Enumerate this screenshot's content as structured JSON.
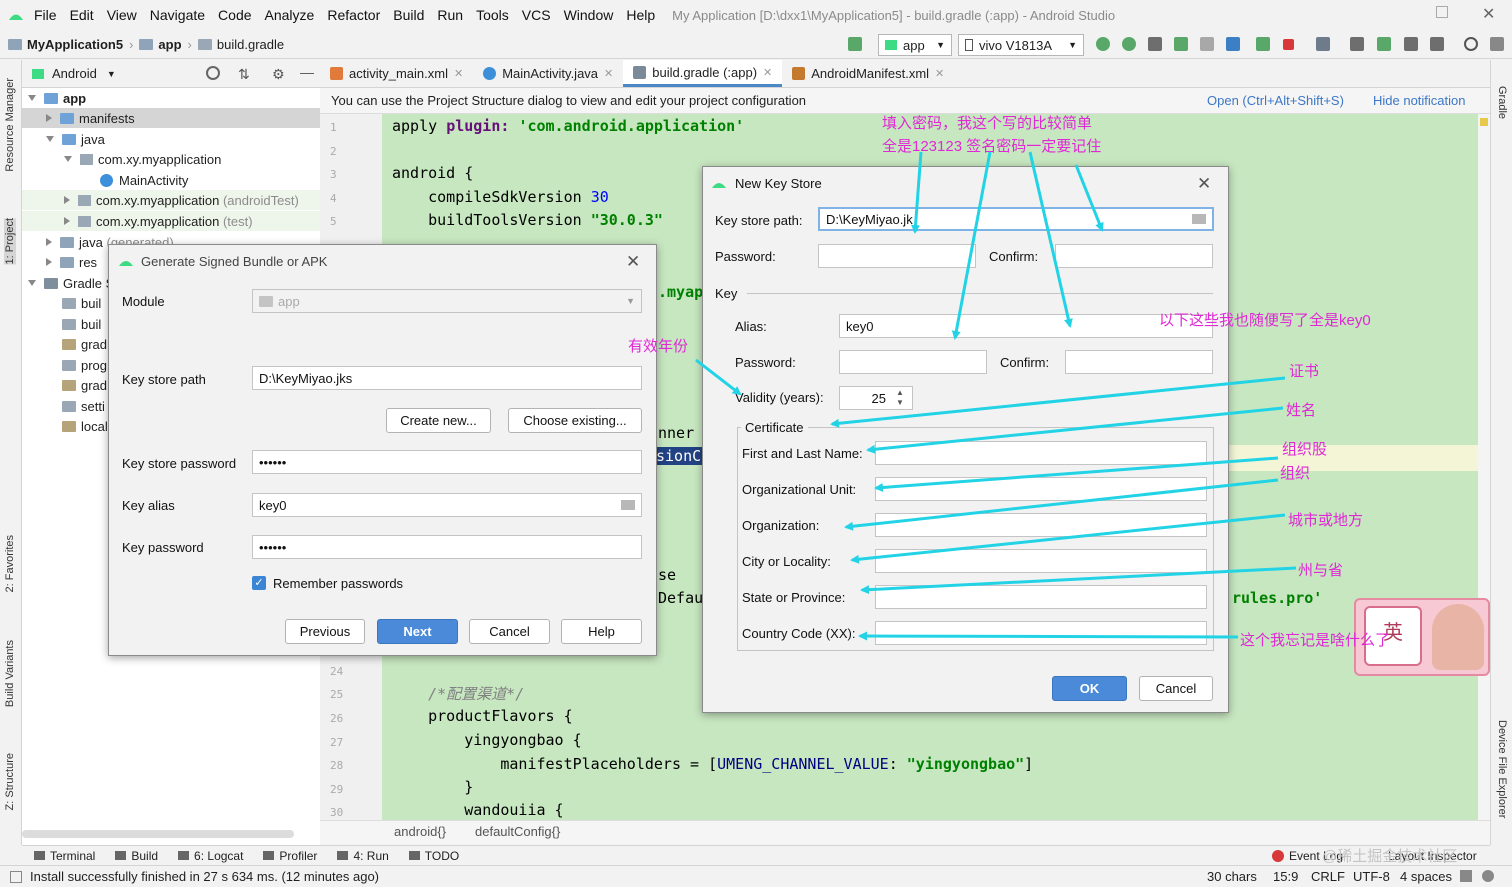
{
  "menubar": {
    "items": [
      "File",
      "Edit",
      "View",
      "Navigate",
      "Code",
      "Analyze",
      "Refactor",
      "Build",
      "Run",
      "Tools",
      "VCS",
      "Window",
      "Help"
    ],
    "window_title": "My Application [D:\\dxx1\\MyApplication5] - build.gradle (:app) - Android Studio"
  },
  "navbar": {
    "crumbs": [
      "MyApplication5",
      "app",
      "build.gradle"
    ],
    "run_config": "app",
    "device": "vivo V1813A"
  },
  "left_strip": {
    "tabs": [
      "Resource Manager",
      "1: Project",
      "2: Favorites",
      "Build Variants",
      "Z: Structure"
    ]
  },
  "right_strip": {
    "tabs": [
      "Gradle",
      "Device File Explorer"
    ]
  },
  "project_panel": {
    "view_selector": "Android",
    "tree": [
      {
        "label": "app",
        "suffix": ""
      },
      {
        "label": "manifests",
        "suffix": ""
      },
      {
        "label": "java",
        "suffix": ""
      },
      {
        "label": "com.xy.myapplication",
        "suffix": ""
      },
      {
        "label": "MainActivity",
        "suffix": ""
      },
      {
        "label": "com.xy.myapplication",
        "suffix": "(androidTest)"
      },
      {
        "label": "com.xy.myapplication",
        "suffix": "(test)"
      },
      {
        "label": "java",
        "suffix": "(generated)"
      },
      {
        "label": "res",
        "suffix": ""
      },
      {
        "label": "Gradle S",
        "suffix": ""
      },
      {
        "label": "buil",
        "suffix": ""
      },
      {
        "label": "buil",
        "suffix": ""
      },
      {
        "label": "grad",
        "suffix": ""
      },
      {
        "label": "prog",
        "suffix": ""
      },
      {
        "label": "grad",
        "suffix": ""
      },
      {
        "label": "setti",
        "suffix": ""
      },
      {
        "label": "local",
        "suffix": ""
      }
    ]
  },
  "editor_tabs": [
    {
      "label": "activity_main.xml",
      "color": "#e07b3c"
    },
    {
      "label": "MainActivity.java",
      "color": "#3d8fd9"
    },
    {
      "label": "build.gradle (:app)",
      "color": "#7a8a99"
    },
    {
      "label": "AndroidManifest.xml",
      "color": "#c47a2e"
    }
  ],
  "notice": {
    "text": "You can use the Project Structure dialog to view and edit your project configuration",
    "open_link": "Open (Ctrl+Alt+Shift+S)",
    "hide_link": "Hide notification"
  },
  "code": {
    "line_numbers": [
      "1",
      "2",
      "3",
      "4",
      "5",
      "24",
      "25",
      "26",
      "27",
      "28",
      "29",
      "30"
    ],
    "l1_a": "apply ",
    "l1_b": "plugin: ",
    "l1_c": "'com.android.application'",
    "l3": "android {",
    "l4_a": "    compileSdkVersion ",
    "l4_b": "30",
    "l5_a": "    buildToolsVersion ",
    "l5_b": "\"30.0.3\"",
    "frag_myapp": ".myapp",
    "frag_nner": "nner '",
    "frag_sionc": "sionCc",
    "frag_se": "se",
    "frag_defau": "Defau",
    "frag_rules": "rules.pro'",
    "comment": "    /*配置渠道*/",
    "pf": "    productFlavors {",
    "yy": "        yingyongbao {",
    "mp_a": "            manifestPlaceholders = [",
    "mp_b": "UMENG_CHANNEL_VALUE",
    "mp_c": ": ",
    "mp_d": "\"yingyongbao\"",
    "mp_e": "]",
    "close": "        }",
    "wdj": "        wandouiia {"
  },
  "breadcrumb": {
    "a": "android{}",
    "b": "defaultConfig{}"
  },
  "toolwindows": [
    "Terminal",
    "Build",
    "6: Logcat",
    "Profiler",
    "4: Run",
    "TODO"
  ],
  "event_log": "Event Log",
  "layout_inspector": "Layout Inspector",
  "status": {
    "message": "Install successfully finished in 27 s 634 ms. (12 minutes ago)",
    "chars": "30 chars",
    "pos": "15:9",
    "crlf": "CRLF",
    "enc": "UTF-8",
    "indent": "4 spaces"
  },
  "gen_dialog": {
    "title": "Generate Signed Bundle or APK",
    "module_label": "Module",
    "module_value": "app",
    "ksp_label": "Key store path",
    "ksp_value": "D:\\KeyMiyao.jks",
    "create_new": "Create new...",
    "choose_existing": "Choose existing...",
    "kspw_label": "Key store password",
    "kspw_value": "••••••",
    "alias_label": "Key alias",
    "alias_value": "key0",
    "kpw_label": "Key password",
    "kpw_value": "••••••",
    "remember": "Remember passwords",
    "previous": "Previous",
    "next": "Next",
    "cancel": "Cancel",
    "help": "Help"
  },
  "ks_dialog": {
    "title": "New Key Store",
    "path_label": "Key store path:",
    "path_value": "D:\\KeyMiyao.jk",
    "password_label": "Password:",
    "confirm_label": "Confirm:",
    "key_section": "Key",
    "alias_label": "Alias:",
    "alias_value": "key0",
    "key_password_label": "Password:",
    "key_confirm_label": "Confirm:",
    "validity_label": "Validity (years):",
    "validity_value": "25",
    "cert_section": "Certificate",
    "first_last": "First and Last Name:",
    "org_unit": "Organizational Unit:",
    "org": "Organization:",
    "city": "City or Locality:",
    "state": "State or Province:",
    "country": "Country Code (XX):",
    "ok": "OK",
    "cancel": "Cancel"
  },
  "annotations": {
    "a1": "填入密码，我这个写的比较简单",
    "a2": "全是123123  签名密码一定要记住",
    "a3": "以下这些我也随便写了全是key0",
    "a4": "有效年份",
    "a5": "证书",
    "a6": "姓名",
    "a7": "组织股",
    "a8": "组织",
    "a9": "城市或地方",
    "a10": "州与省",
    "a11": "这个我忘记是啥什么了",
    "sticker": "英",
    "watermark": "@稀土掘金技术社区"
  },
  "colors": {
    "code_bg": "#c7e7c0",
    "annotation": "#e028d6",
    "arrow": "#22d3e6",
    "primary_button": "#4a8ad8"
  }
}
